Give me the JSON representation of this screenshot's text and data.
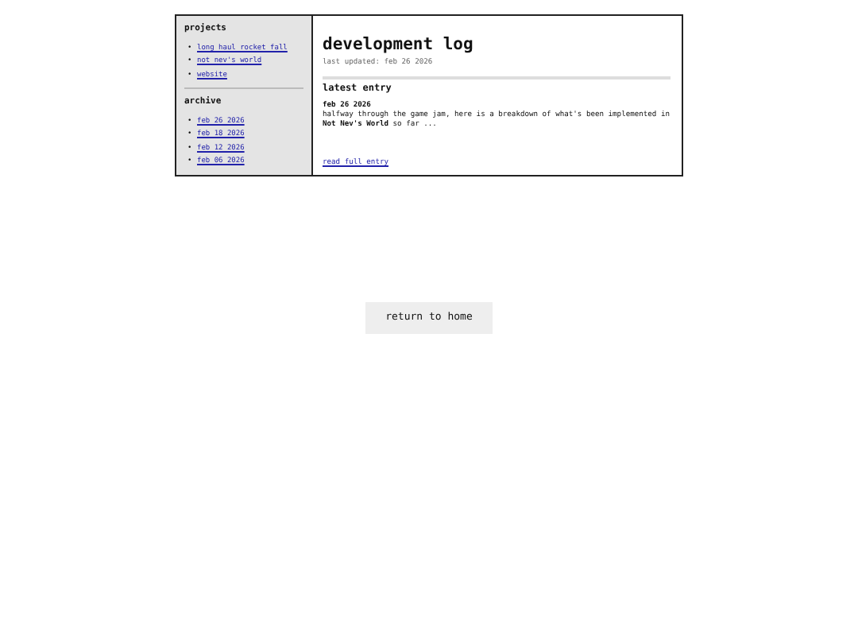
{
  "sidebar": {
    "sections": [
      {
        "title": "projects",
        "links": [
          {
            "marker": "•",
            "label": "long haul rocket fall"
          },
          {
            "marker": "•",
            "label": "not nev's world"
          },
          {
            "marker": "•",
            "label": "website"
          }
        ]
      },
      {
        "title": "archive",
        "links": [
          {
            "marker": "•",
            "label": "feb 26 2026"
          },
          {
            "marker": "•",
            "label": "feb 18 2026"
          },
          {
            "marker": "•",
            "label": "feb 12 2026"
          },
          {
            "marker": "•",
            "label": "feb 06 2026"
          }
        ]
      }
    ]
  },
  "main": {
    "title": "development log",
    "updated": "last updated: feb 26 2026",
    "section_title": "latest entry",
    "entry": {
      "date": "feb 26 2026",
      "text": "halfway through the game jam, here is a breakdown of what's been implemented in **Not Nev's World** so far ...",
      "link": "read full entry"
    }
  },
  "button": "return to home"
}
